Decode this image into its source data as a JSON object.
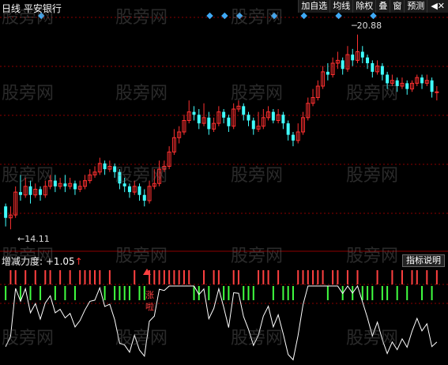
{
  "header": {
    "title": "日线  平安银行",
    "toolbar": [
      "加自选",
      "均线",
      "除权",
      "叠",
      "窗",
      "预测"
    ],
    "close_icon": "close-icon"
  },
  "watermark": "股旁网",
  "price_labels": {
    "high": "20.88",
    "low": "14.11"
  },
  "indicator": {
    "name": "增减力度",
    "value": "+1.05",
    "help_button": "指标说明",
    "signal_text": [
      "涨",
      "啦"
    ]
  },
  "colors": {
    "up": "#ff3030",
    "down": "#40ffff",
    "signal_up": "#ff4040",
    "signal_down": "#40ff40",
    "line": "#ffffff",
    "grid": "#8b0000"
  },
  "chart_data": {
    "type": "candlestick",
    "ylim": [
      13.5,
      21.5
    ],
    "candles": [
      [
        14.9,
        14.5,
        15.0,
        14.2
      ],
      [
        14.5,
        14.6,
        14.9,
        14.1
      ],
      [
        14.6,
        15.4,
        15.6,
        14.5
      ],
      [
        15.4,
        15.3,
        16.0,
        15.1
      ],
      [
        15.3,
        15.6,
        15.9,
        15.2
      ],
      [
        15.6,
        15.3,
        15.8,
        15.0
      ],
      [
        15.3,
        15.5,
        15.7,
        15.2
      ],
      [
        15.5,
        15.3,
        15.6,
        15.1
      ],
      [
        15.3,
        15.6,
        15.8,
        15.2
      ],
      [
        15.6,
        15.8,
        16.0,
        15.5
      ],
      [
        15.8,
        15.6,
        16.0,
        15.4
      ],
      [
        15.6,
        15.7,
        15.9,
        15.5
      ],
      [
        15.7,
        15.6,
        16.0,
        15.4
      ],
      [
        15.6,
        15.7,
        15.9,
        15.5
      ],
      [
        15.7,
        15.5,
        15.8,
        15.3
      ],
      [
        15.5,
        15.6,
        15.8,
        15.4
      ],
      [
        15.6,
        15.8,
        16.0,
        15.5
      ],
      [
        15.8,
        16.0,
        16.2,
        15.7
      ],
      [
        16.0,
        16.1,
        16.3,
        15.9
      ],
      [
        16.1,
        16.4,
        16.6,
        16.0
      ],
      [
        16.4,
        16.2,
        16.5,
        16.0
      ],
      [
        16.2,
        16.3,
        16.5,
        16.1
      ],
      [
        16.3,
        16.1,
        16.4,
        15.9
      ],
      [
        16.1,
        15.7,
        16.2,
        15.5
      ],
      [
        15.7,
        15.6,
        15.9,
        15.4
      ],
      [
        15.6,
        15.4,
        15.7,
        15.2
      ],
      [
        15.4,
        15.6,
        15.8,
        15.3
      ],
      [
        15.6,
        15.3,
        15.7,
        15.1
      ],
      [
        15.3,
        15.1,
        15.5,
        14.9
      ],
      [
        15.1,
        15.6,
        15.8,
        15.0
      ],
      [
        15.6,
        15.7,
        16.2,
        15.5
      ],
      [
        15.7,
        16.2,
        16.5,
        15.6
      ],
      [
        16.2,
        16.3,
        16.5,
        16.1
      ],
      [
        16.3,
        16.8,
        17.0,
        16.2
      ],
      [
        16.8,
        17.3,
        17.6,
        16.7
      ],
      [
        17.3,
        17.5,
        17.7,
        17.1
      ],
      [
        17.5,
        17.9,
        18.1,
        17.4
      ],
      [
        17.9,
        18.2,
        18.6,
        17.8
      ],
      [
        18.2,
        18.1,
        18.4,
        17.9
      ],
      [
        18.1,
        17.8,
        18.3,
        17.6
      ],
      [
        17.8,
        18.0,
        18.5,
        17.7
      ],
      [
        18.0,
        17.6,
        18.2,
        17.4
      ],
      [
        17.6,
        17.8,
        18.0,
        17.5
      ],
      [
        17.8,
        18.2,
        18.4,
        17.7
      ],
      [
        18.2,
        18.0,
        18.3,
        17.8
      ],
      [
        18.0,
        17.7,
        18.1,
        17.5
      ],
      [
        17.7,
        18.3,
        18.5,
        17.6
      ],
      [
        18.3,
        18.4,
        18.6,
        18.2
      ],
      [
        18.4,
        18.1,
        18.5,
        17.9
      ],
      [
        18.1,
        17.9,
        18.2,
        17.7
      ],
      [
        17.9,
        17.6,
        18.0,
        17.4
      ],
      [
        17.6,
        17.7,
        18.2,
        17.5
      ],
      [
        17.7,
        18.0,
        18.3,
        17.6
      ],
      [
        18.0,
        18.2,
        18.4,
        17.9
      ],
      [
        18.2,
        17.9,
        18.3,
        17.8
      ],
      [
        17.9,
        18.1,
        18.3,
        17.8
      ],
      [
        18.1,
        17.8,
        18.2,
        17.6
      ],
      [
        17.8,
        17.4,
        17.9,
        17.2
      ],
      [
        17.4,
        17.2,
        17.5,
        17.0
      ],
      [
        17.2,
        17.5,
        17.8,
        17.1
      ],
      [
        17.5,
        18.0,
        18.2,
        17.4
      ],
      [
        18.0,
        18.5,
        18.7,
        17.9
      ],
      [
        18.5,
        18.7,
        19.0,
        18.4
      ],
      [
        18.7,
        19.1,
        19.3,
        18.6
      ],
      [
        19.1,
        19.6,
        19.8,
        19.0
      ],
      [
        19.6,
        19.5,
        19.9,
        19.3
      ],
      [
        19.5,
        19.9,
        20.1,
        19.4
      ],
      [
        19.9,
        20.0,
        20.3,
        19.7
      ],
      [
        20.0,
        19.7,
        20.1,
        19.5
      ],
      [
        19.7,
        20.2,
        20.5,
        19.6
      ],
      [
        20.2,
        20.0,
        20.4,
        19.8
      ],
      [
        20.0,
        20.3,
        20.9,
        19.9
      ],
      [
        20.3,
        20.1,
        20.5,
        19.9
      ],
      [
        20.1,
        19.9,
        20.2,
        19.7
      ],
      [
        19.9,
        19.6,
        20.0,
        19.4
      ],
      [
        19.6,
        19.8,
        20.0,
        19.5
      ],
      [
        19.8,
        19.5,
        19.9,
        19.3
      ],
      [
        19.5,
        19.2,
        19.6,
        19.0
      ],
      [
        19.2,
        19.3,
        19.5,
        19.1
      ],
      [
        19.3,
        19.1,
        19.4,
        18.9
      ],
      [
        19.1,
        19.2,
        19.4,
        19.0
      ],
      [
        19.2,
        19.0,
        19.3,
        18.8
      ],
      [
        19.0,
        19.2,
        19.3,
        18.9
      ],
      [
        19.2,
        19.4,
        19.5,
        19.1
      ],
      [
        19.4,
        19.2,
        19.5,
        19.0
      ],
      [
        19.2,
        19.3,
        19.5,
        19.1
      ],
      [
        19.3,
        18.9,
        19.4,
        18.7
      ],
      [
        18.9,
        18.9,
        19.1,
        18.6
      ]
    ],
    "marker_positions": [
      4,
      38,
      41,
      44,
      51,
      57,
      64,
      71
    ]
  }
}
